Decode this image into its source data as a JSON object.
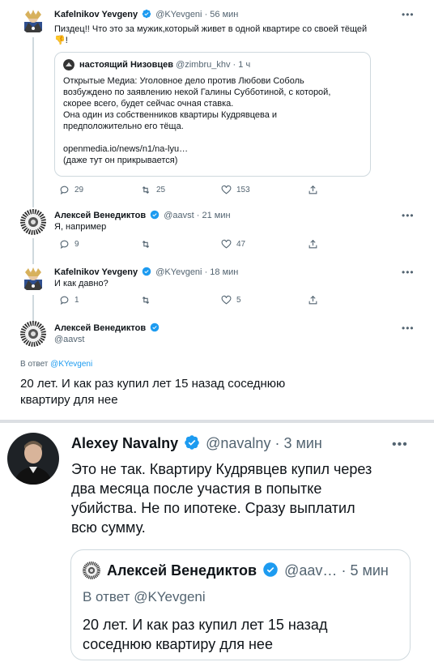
{
  "top": {
    "tweet1": {
      "name": "Kafelnikov Yevgeny",
      "handle": "@KYevgeni",
      "dot": "·",
      "time": "56 мин",
      "text": "Пиздец!! Что это за мужик,который живет в одной квартире со своей тёщей",
      "emoji": "👎",
      "emoji_suffix": "!",
      "quote": {
        "name": "настоящий Низовцев",
        "handle": "@zimbru_khv",
        "dot": "·",
        "time": "1 ч",
        "lines": [
          "Открытые Медиа: Уголовное дело против Любови Соболь",
          "возбуждено по заявлению некой Галины Субботиной, с которой,",
          "скорее всего, будет сейчас очная ставка.",
          "Она один из собственников квартиры Кудрявцева и",
          "предположительно его тёща."
        ],
        "link": "openmedia.io/news/n1/na-lyu…",
        "note": "(даже тут он прикрывается)"
      },
      "replies": "29",
      "retweets": "25",
      "likes": "153"
    },
    "tweet2": {
      "name": "Алексей Венедиктов",
      "handle": "@aavst",
      "dot": "·",
      "time": "21 мин",
      "text": "Я, например",
      "replies": "9",
      "retweets": "",
      "likes": "47"
    },
    "tweet3": {
      "name": "Kafelnikov Yevgeny",
      "handle": "@KYevgeni",
      "dot": "·",
      "time": "18 мин",
      "text": "И как давно?",
      "replies": "1",
      "retweets": "",
      "likes": "5"
    },
    "tweet4": {
      "name": "Алексей Венедиктов",
      "handle": "@aavst",
      "reply_prefix": "В ответ",
      "reply_handle": "@KYevgeni",
      "text_lines": [
        "20 лет. И как раз купил лет 15 назад соседнюю",
        "квартиру для нее"
      ]
    }
  },
  "bottom": {
    "name": "Alexey Navalny",
    "handle": "@navalny",
    "dot": "·",
    "time": "3 мин",
    "text_lines": [
      "Это не так. Квартиру Кудрявцев купил через",
      "два месяца после участия в попытке",
      "убийства. Не по ипотеке. Сразу выплатил",
      "всю сумму."
    ],
    "quote": {
      "name": "Алексей Венедиктов",
      "handle": "@aav…",
      "dot": "·",
      "time": "5 мин",
      "reply_prefix": "В ответ",
      "reply_handle": "@KYevgeni",
      "text_lines": [
        "20 лет. И как раз купил лет 15 назад",
        "соседнюю квартиру для нее"
      ]
    }
  },
  "icons": {
    "more": "more-icon",
    "verified": "verified-badge-icon",
    "reply": "reply-icon",
    "retweet": "retweet-icon",
    "like": "like-icon",
    "share": "share-icon"
  },
  "colors": {
    "accent": "#1d9bf0",
    "secondary_text": "#536471",
    "border": "#cfd9de"
  }
}
